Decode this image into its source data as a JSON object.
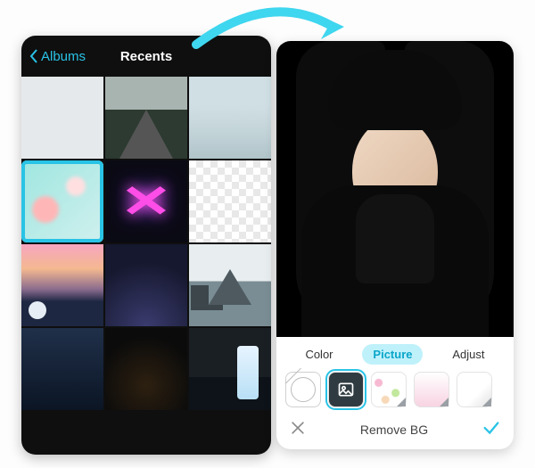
{
  "picker": {
    "back_label": "Albums",
    "title": "Recents",
    "thumbs": [
      {
        "name": "thumb-snow"
      },
      {
        "name": "thumb-road"
      },
      {
        "name": "thumb-ice"
      },
      {
        "name": "thumb-bokeh",
        "selected": true
      },
      {
        "name": "thumb-neon"
      },
      {
        "name": "thumb-transparent"
      },
      {
        "name": "thumb-sunset"
      },
      {
        "name": "thumb-starry"
      },
      {
        "name": "thumb-mountain"
      },
      {
        "name": "thumb-night"
      },
      {
        "name": "thumb-camp"
      },
      {
        "name": "thumb-waterfall"
      }
    ]
  },
  "editor": {
    "tabs": {
      "color": "Color",
      "picture": "Picture",
      "adjust": "Adjust",
      "active": "picture"
    },
    "swatches": [
      {
        "name": "swatch-none"
      },
      {
        "name": "swatch-image",
        "selected": true
      },
      {
        "name": "swatch-pattern"
      },
      {
        "name": "swatch-pink"
      },
      {
        "name": "swatch-marble"
      }
    ],
    "action_title": "Remove BG"
  },
  "colors": {
    "accent": "#29c3e6"
  }
}
